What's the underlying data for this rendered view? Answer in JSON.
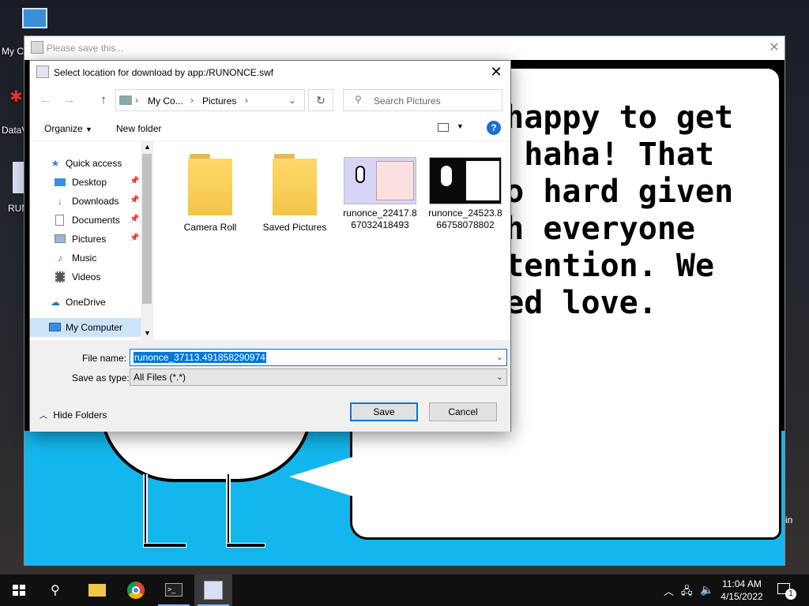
{
  "desktop": {
    "icons": [
      {
        "label": "My C"
      },
      {
        "label": "DataV"
      },
      {
        "label": "RUN"
      }
    ]
  },
  "app_window": {
    "title": "Please save this...",
    "speech_text": "r happy to get\nd, haha! That\n so hard given\nuch everyone\nattention. We\nneed love.",
    "partial_label": "in"
  },
  "dialog": {
    "title": "Select location for download by app:/RUNONCE.swf",
    "address": {
      "segments": [
        "My Co...",
        "Pictures"
      ]
    },
    "search_placeholder": "Search Pictures",
    "toolbar": {
      "organize_label": "Organize",
      "new_folder_label": "New folder"
    },
    "nav": {
      "quick_access": "Quick access",
      "items": [
        {
          "label": "Desktop"
        },
        {
          "label": "Downloads"
        },
        {
          "label": "Documents"
        },
        {
          "label": "Pictures"
        },
        {
          "label": "Music"
        },
        {
          "label": "Videos"
        }
      ],
      "onedrive": "OneDrive",
      "my_computer": "My Computer"
    },
    "files": [
      {
        "name": "Camera Roll",
        "type": "folder"
      },
      {
        "name": "Saved Pictures",
        "type": "folder"
      },
      {
        "name_line1": "runonce_22417.8",
        "name_line2": "67032418493",
        "type": "image"
      },
      {
        "name_line1": "runonce_24523.8",
        "name_line2": "66758078802",
        "type": "image"
      }
    ],
    "file_name_label": "File name:",
    "file_name_value": "runonce_37113.491858290974",
    "save_type_label": "Save as type:",
    "save_type_value": "All Files (*.*)",
    "hide_folders_label": "Hide Folders",
    "save_label": "Save",
    "cancel_label": "Cancel"
  },
  "taskbar": {
    "time": "11:04 AM",
    "date": "4/15/2022",
    "notification_count": "1"
  },
  "colors": {
    "accent": "#0078d7",
    "sky": "#13b7ee",
    "taskbar": "#101010"
  }
}
